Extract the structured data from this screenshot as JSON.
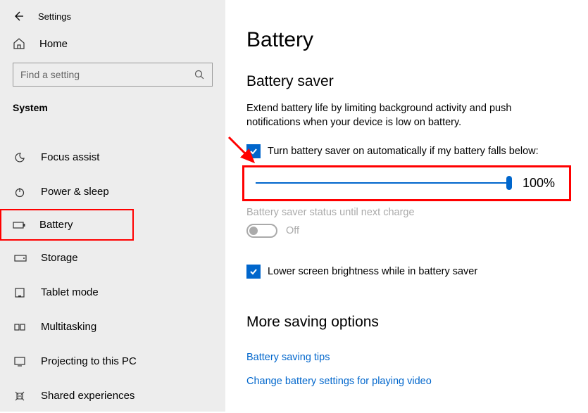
{
  "header": {
    "title": "Settings"
  },
  "sidebar": {
    "home": "Home",
    "search_placeholder": "Find a setting",
    "section": "System",
    "items": [
      {
        "id": "focus-assist",
        "label": "Focus assist"
      },
      {
        "id": "power-sleep",
        "label": "Power & sleep"
      },
      {
        "id": "battery",
        "label": "Battery",
        "highlighted": true
      },
      {
        "id": "storage",
        "label": "Storage"
      },
      {
        "id": "tablet-mode",
        "label": "Tablet mode"
      },
      {
        "id": "multitasking",
        "label": "Multitasking"
      },
      {
        "id": "projecting",
        "label": "Projecting to this PC"
      },
      {
        "id": "shared-experiences",
        "label": "Shared experiences"
      }
    ]
  },
  "main": {
    "page_title": "Battery",
    "saver_title": "Battery saver",
    "saver_desc": "Extend battery life by limiting background activity and push notifications when your device is low on battery.",
    "auto_on_label": "Turn battery saver on automatically if my battery falls below:",
    "slider_value": "100%",
    "status_label": "Battery saver status until next charge",
    "toggle_state": "Off",
    "brightness_label": "Lower screen brightness while in battery saver",
    "more_options_title": "More saving options",
    "link_tips": "Battery saving tips",
    "link_video": "Change battery settings for playing video"
  }
}
